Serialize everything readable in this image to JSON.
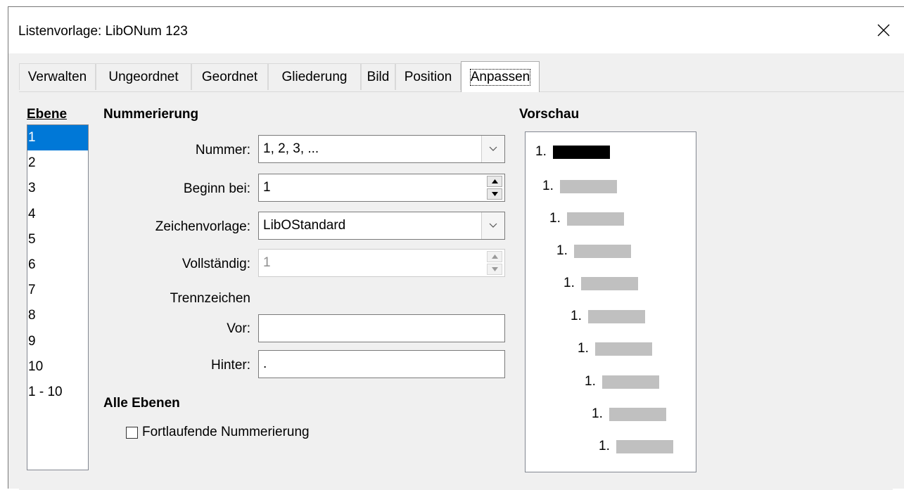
{
  "window": {
    "title": "Listenvorlage: LibONum 123"
  },
  "tabs": [
    {
      "label": "Verwalten"
    },
    {
      "label": "Ungeordnet"
    },
    {
      "label": "Geordnet"
    },
    {
      "label": "Gliederung"
    },
    {
      "label": "Bild"
    },
    {
      "label": "Position"
    },
    {
      "label": "Anpassen",
      "active": true
    }
  ],
  "level_section": {
    "heading": "Ebene",
    "items": [
      "1",
      "2",
      "3",
      "4",
      "5",
      "6",
      "7",
      "8",
      "9",
      "10",
      "1 - 10"
    ],
    "selected": "1"
  },
  "numbering": {
    "heading": "Nummerierung",
    "number_label": "Nummer:",
    "number_value": "1, 2, 3, ...",
    "start_label": "Beginn bei:",
    "start_value": "1",
    "char_style_label": "Zeichenvorlage:",
    "char_style_value": "LibOStandard",
    "show_sublevels_label": "Vollständig:",
    "show_sublevels_value": "1",
    "separator_heading": "Trennzeichen",
    "before_label": "Vor:",
    "before_value": "",
    "after_label": "Hinter:",
    "after_value": "."
  },
  "all_levels": {
    "heading": "Alle Ebenen",
    "consecutive_label": "Fortlaufende Nummerierung",
    "consecutive_checked": false
  },
  "preview": {
    "heading": "Vorschau",
    "rows": [
      "1.",
      "1.",
      "1.",
      "1.",
      "1.",
      "1.",
      "1.",
      "1.",
      "1.",
      "1."
    ],
    "highlight_color": "#000000",
    "placeholder_color": "#c0c0c0"
  },
  "colors": {
    "selection": "#0078d7",
    "dialog_bg": "#f0f0f0"
  }
}
